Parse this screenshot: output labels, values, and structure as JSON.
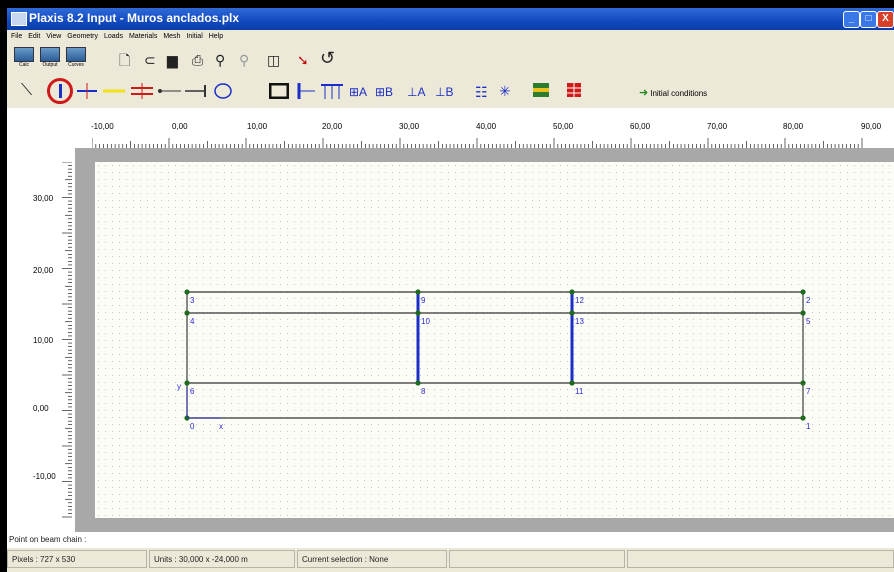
{
  "window": {
    "title": "Plaxis 8.2 Input - Muros anclados.plx",
    "controls": [
      "_",
      "□",
      "X"
    ]
  },
  "menu": [
    "File",
    "Edit",
    "View",
    "Geometry",
    "Loads",
    "Materials",
    "Mesh",
    "Initial",
    "Help"
  ],
  "toolbar1": {
    "calc": "Calc",
    "output": "Output",
    "curves": "Curves",
    "icons": [
      "new-file-icon",
      "open-icon",
      "save-icon",
      "print-icon",
      "zoom-in-icon",
      "zoom-out-icon",
      "table-icon",
      "pointer-icon",
      "undo-icon"
    ]
  },
  "toolbar2": {
    "selected_tool": "plate-icon",
    "tools": [
      "geometry-line-icon",
      "plate-icon",
      "geogrid-icon",
      "interface-icon",
      "node-to-node-anchor-icon",
      "fixed-end-anchor-icon",
      "tunnel-icon",
      "standard-fixities-icon",
      "horizontal-fixity-icon",
      "vertical-fixity-icon",
      "load-system-a-icon",
      "load-system-b-icon",
      "point-load-a-icon",
      "point-load-b-icon",
      "prescribed-displacement-icon",
      "rotation-fixity-icon",
      "materials-icon",
      "mesh-icon"
    ],
    "initial_conditions": "Initial conditions"
  },
  "ruler_h": [
    "-10,00",
    "0,00",
    "10,00",
    "20,00",
    "30,00",
    "40,00",
    "50,00",
    "60,00",
    "70,00",
    "80,00",
    "90,00"
  ],
  "ruler_v": [
    "30,00",
    "20,00",
    "10,00",
    "0,00",
    "-10,00"
  ],
  "model": {
    "points": [
      {
        "id": "0",
        "x": 0,
        "y": 0
      },
      {
        "id": "1",
        "x": 80,
        "y": 0
      },
      {
        "id": "2",
        "x": 80,
        "y": 18
      },
      {
        "id": "3",
        "x": 0,
        "y": 18
      },
      {
        "id": "4",
        "x": 0,
        "y": 15
      },
      {
        "id": "5",
        "x": 80,
        "y": 15
      },
      {
        "id": "6",
        "x": 0,
        "y": 5
      },
      {
        "id": "7",
        "x": 80,
        "y": 5
      },
      {
        "id": "8",
        "x": 30,
        "y": 5
      },
      {
        "id": "9",
        "x": 30,
        "y": 18
      },
      {
        "id": "10",
        "x": 30,
        "y": 15
      },
      {
        "id": "11",
        "x": 50,
        "y": 5
      },
      {
        "id": "12",
        "x": 50,
        "y": 18
      },
      {
        "id": "13",
        "x": 50,
        "y": 15
      }
    ],
    "axis_y_label": "y",
    "axis_x_label": "x"
  },
  "status": {
    "message": "Point on beam chain :",
    "pixels": "Pixels : 727 x 530",
    "units": "Units : 30,000 x -24,000 m",
    "selection": "Current selection : None"
  },
  "colors": {
    "titlebar": "#1149c0",
    "plate": "#1c2ec8",
    "nodes": "#1e6b1e",
    "selection_ring": "#d01a1a"
  }
}
